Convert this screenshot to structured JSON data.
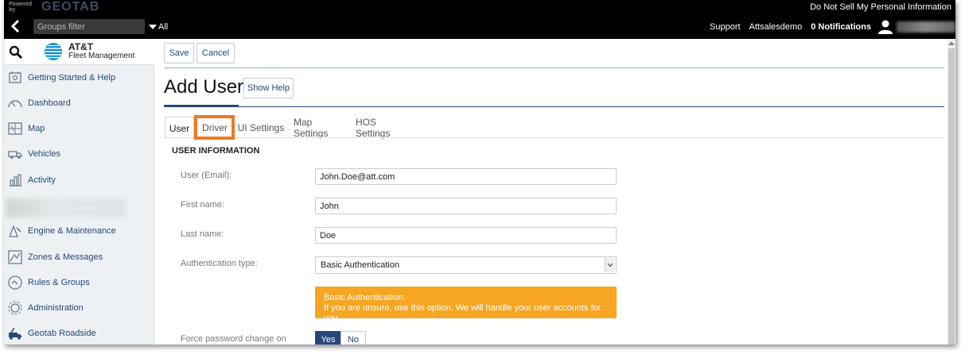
{
  "topbar": {
    "powered_by": "Powered by",
    "logo": "GEOTAB",
    "do_not_sell": "Do Not Sell My Personal Information",
    "groups_filter_placeholder": "Groups filter",
    "all_label": "All",
    "support": "Support",
    "account": "Attsalesdemo",
    "notifications": "0 Notifications"
  },
  "sidebar": {
    "brand_line1": "AT&T",
    "brand_line2": "Fleet Management",
    "items": [
      {
        "label": "Getting Started & Help",
        "icon": "help-book-icon"
      },
      {
        "label": "Dashboard",
        "icon": "gauge-icon"
      },
      {
        "label": "Map",
        "icon": "map-icon"
      },
      {
        "label": "Vehicles",
        "icon": "truck-icon"
      },
      {
        "label": "Activity",
        "icon": "bar-chart-icon"
      },
      {
        "label": "Engine & Maintenance",
        "icon": "wrench-icon"
      },
      {
        "label": "Zones & Messages",
        "icon": "zone-icon"
      },
      {
        "label": "Rules & Groups",
        "icon": "rules-icon"
      },
      {
        "label": "Administration",
        "icon": "gear-icon"
      },
      {
        "label": "Geotab Roadside",
        "icon": "tow-truck-icon"
      }
    ]
  },
  "toolbar": {
    "save": "Save",
    "cancel": "Cancel"
  },
  "page": {
    "title": "Add User",
    "show_help": "Show Help"
  },
  "tabs": [
    "User",
    "Driver",
    "UI Settings",
    "Map Settings",
    "HOS Settings"
  ],
  "form": {
    "section": "USER INFORMATION",
    "email_label": "User (Email):",
    "email_value": "John.Doe@att.com",
    "first_name_label": "First name:",
    "first_name_value": "John",
    "last_name_label": "Last name:",
    "last_name_value": "Doe",
    "auth_label": "Authentication type:",
    "auth_value": "Basic Authentication",
    "info_title": "Basic Authentication:",
    "info_text": "If you are unsure, use this option. We will handle your user accounts for you.",
    "force_pw_label": "Force password change on",
    "yes": "Yes",
    "no": "No"
  },
  "colors": {
    "accent": "#25477b",
    "highlight": "#f07820",
    "info": "#f6a623"
  }
}
